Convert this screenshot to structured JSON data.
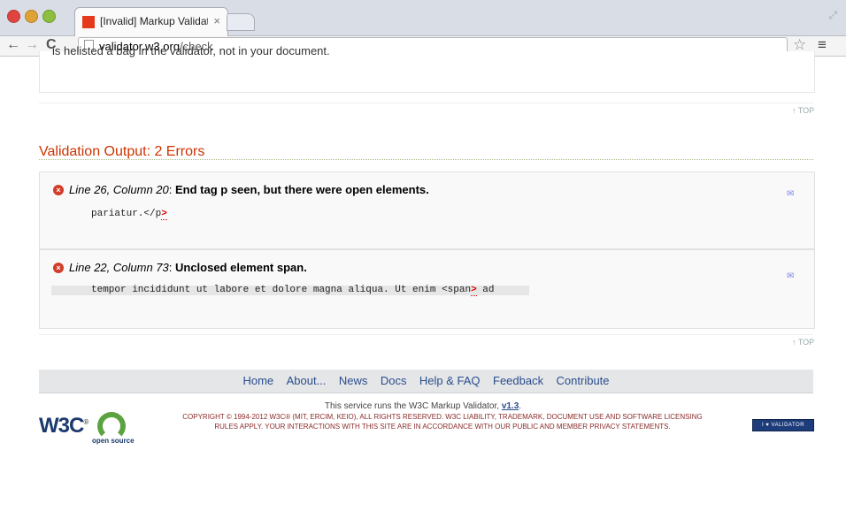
{
  "browser": {
    "tab_title": "[Invalid] Markup Validation",
    "tab_close": "×",
    "url_host": "validator.w3.org",
    "url_path": "/check"
  },
  "page": {
    "prev_box_text": "is helisted a bag in the validator, not in your document.",
    "top_link": "↑ TOP",
    "heading": "Validation Output: 2 Errors",
    "errors": [
      {
        "location": "Line 26, Column 20",
        "message": "End tag p seen, but there were open elements.",
        "code_before": "pariatur.</p",
        "code_highlight": ">",
        "code_after": ""
      },
      {
        "location": "Line 22, Column 73",
        "message": "Unclosed element span.",
        "code_before": "tempor incididunt ut labore et dolore magna aliqua. Ut enim <span",
        "code_highlight": ">",
        "code_after": "ad"
      }
    ],
    "footer_nav": [
      "Home",
      "About...",
      "News",
      "Docs",
      "Help & FAQ",
      "Feedback",
      "Contribute"
    ],
    "runs_text": "This service runs the W3C Markup Validator,",
    "version": "v1.3",
    "copyright_line1": "COPYRIGHT © 1994-2012 W3C® (MIT, ERCIM, KEIO), ALL RIGHTS RESERVED. W3C LIABILITY, TRADEMARK, DOCUMENT USE AND SOFTWARE LICENSING",
    "copyright_line2": "RULES APPLY. YOUR INTERACTIONS WITH THIS SITE ARE IN ACCORDANCE WITH OUR PUBLIC AND MEMBER PRIVACY STATEMENTS.",
    "w3c_logo": "W3C",
    "open_source_label": "open source",
    "badge_text": "I ♥ VALIDATOR"
  },
  "colors": {
    "heading": "#cc3300",
    "link": "#2b4d8c",
    "error_icon": "#d23c2a"
  }
}
